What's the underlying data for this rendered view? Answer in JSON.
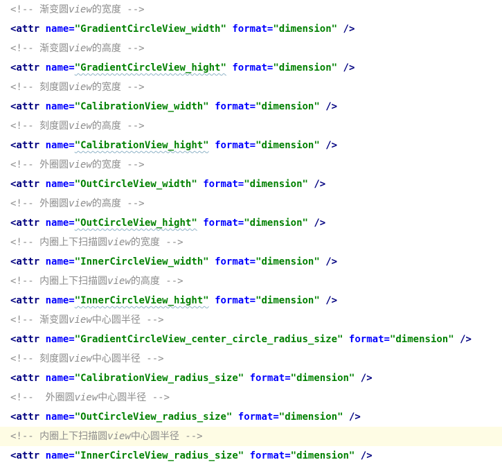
{
  "colors": {
    "comment": "#8c8c8c",
    "tag": "#000080",
    "attribute_name": "#0000ff",
    "attribute_value": "#008000",
    "highlight_line": "#fefce4"
  },
  "lines": [
    {
      "type": "comment",
      "text": "<!-- 渐变圆view的宽度 -->"
    },
    {
      "type": "attr",
      "name": "\"GradientCircleView_width\"",
      "format": "\"dimension\""
    },
    {
      "type": "comment",
      "text": "<!-- 渐变圆view的高度 -->"
    },
    {
      "type": "attr",
      "name": "\"GradientCircleView_hight\"",
      "format": "\"dimension\""
    },
    {
      "type": "comment",
      "text": "<!-- 刻度圆view的宽度 -->"
    },
    {
      "type": "attr",
      "name": "\"CalibrationView_width\"",
      "format": "\"dimension\""
    },
    {
      "type": "comment",
      "text": "<!-- 刻度圆view的高度 -->"
    },
    {
      "type": "attr",
      "name": "\"CalibrationView_hight\"",
      "format": "\"dimension\""
    },
    {
      "type": "comment",
      "text": "<!-- 外圈圆view的宽度 -->"
    },
    {
      "type": "attr",
      "name": "\"OutCircleView_width\"",
      "format": "\"dimension\""
    },
    {
      "type": "comment",
      "text": "<!-- 外圈圆view的高度 -->"
    },
    {
      "type": "attr",
      "name": "\"OutCircleView_hight\"",
      "format": "\"dimension\""
    },
    {
      "type": "comment",
      "text": "<!-- 内圈上下扫描圆view的宽度 -->"
    },
    {
      "type": "attr",
      "name": "\"InnerCircleView_width\"",
      "format": "\"dimension\""
    },
    {
      "type": "comment",
      "text": "<!-- 内圈上下扫描圆view的高度 -->"
    },
    {
      "type": "attr",
      "name": "\"InnerCircleView_hight\"",
      "format": "\"dimension\""
    },
    {
      "type": "comment",
      "text": "<!-- 渐变圆view中心圆半径 -->"
    },
    {
      "type": "attr",
      "name": "\"GradientCircleView_center_circle_radius_size\"",
      "format": "\"dimension\""
    },
    {
      "type": "comment",
      "text": "<!-- 刻度圆view中心圆半径 -->"
    },
    {
      "type": "attr",
      "name": "\"CalibrationView_radius_size\"",
      "format": "\"dimension\""
    },
    {
      "type": "comment",
      "text": "<!--  外圈圆view中心圆半径 -->"
    },
    {
      "type": "attr",
      "name": "\"OutCircleView_radius_size\"",
      "format": "\"dimension\""
    },
    {
      "type": "comment",
      "text": "<!-- 内圈上下扫描圆view中心圆半径 -->",
      "highlight": true
    },
    {
      "type": "attr",
      "name": "\"InnerCircleView_radius_size\"",
      "format": "\"dimension\""
    }
  ],
  "tokens": {
    "open_tag": "<attr",
    "name_attr": "name=",
    "format_attr": "format=",
    "close_tag": "/>"
  }
}
